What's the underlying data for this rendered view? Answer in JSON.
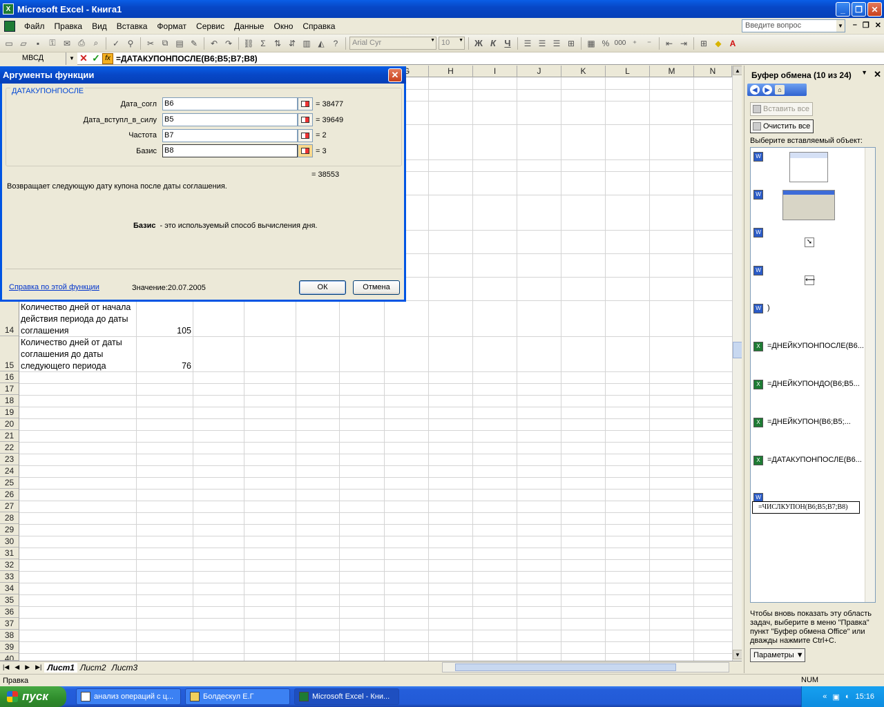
{
  "window": {
    "title": "Microsoft Excel - Книга1",
    "app_icon": "X"
  },
  "menu": {
    "items": [
      "Файл",
      "Правка",
      "Вид",
      "Вставка",
      "Формат",
      "Сервис",
      "Данные",
      "Окно",
      "Справка"
    ],
    "ask_placeholder": "Введите вопрос"
  },
  "toolbar": {
    "font_name": "Arial Cyr",
    "font_size": "10",
    "bold": "Ж",
    "italic": "К",
    "underline": "Ч",
    "percent": "%",
    "thousands": "000",
    "sigma": "Σ"
  },
  "formula_bar": {
    "name_box": "МВСД",
    "formula": "=ДАТАКУПОНПОСЛЕ(B6;B5;B7;B8)",
    "fx": "fx"
  },
  "grid": {
    "columns": [
      "G",
      "H",
      "I",
      "J",
      "K",
      "L",
      "M",
      "N"
    ],
    "rows": [
      "14",
      "15",
      "16",
      "17",
      "18",
      "19",
      "20",
      "21",
      "22",
      "23",
      "24",
      "25",
      "26",
      "27",
      "28",
      "29",
      "30",
      "31",
      "32",
      "33",
      "34",
      "35",
      "36",
      "37",
      "38",
      "39",
      "40"
    ],
    "cells": [
      {
        "row": "14",
        "lines": [
          "Количество дней от начала",
          "действия периода до даты",
          "соглашения"
        ],
        "value": "105"
      },
      {
        "row": "15",
        "lines": [
          "Количество дней от даты",
          "соглашения до даты",
          "следующего периода"
        ],
        "value": "76"
      }
    ]
  },
  "sheets": {
    "tabs": [
      "Лист1",
      "Лист2",
      "Лист3"
    ],
    "active": "Лист1"
  },
  "status": {
    "left": "Правка",
    "num": "NUM"
  },
  "dialog": {
    "title": "Аргументы функции",
    "function_name": "ДАТАКУПОНПОСЛЕ",
    "args": [
      {
        "label": "Дата_согл",
        "input": "B6",
        "value": "= 38477"
      },
      {
        "label": "Дата_вступл_в_силу",
        "input": "B5",
        "value": "= 39649"
      },
      {
        "label": "Частота",
        "input": "B7",
        "value": "= 2"
      },
      {
        "label": "Базис",
        "input": "B8",
        "value": "= 3"
      }
    ],
    "result": "= 38553",
    "description": "Возвращает следующую дату купона после даты соглашения.",
    "arg_name": "Базис",
    "arg_description": "- это используемый способ вычисления дня.",
    "help_link": "Справка по этой функции",
    "value_label": "Значение:",
    "value": "20.07.2005",
    "ok": "ОК",
    "cancel": "Отмена"
  },
  "taskpane": {
    "title": "Буфер обмена (10 из 24)",
    "paste_all": "Вставить все",
    "clear_all": "Очистить все",
    "select_label": "Выберите вставляемый объект:",
    "items": [
      {
        "type": "word",
        "kind": "image"
      },
      {
        "type": "word",
        "kind": "image"
      },
      {
        "type": "word",
        "kind": "arrow",
        "glyph": "➘"
      },
      {
        "type": "word",
        "kind": "arrow",
        "glyph": "⟵"
      },
      {
        "type": "word",
        "kind": "text",
        "text": ")"
      },
      {
        "type": "excel",
        "kind": "text",
        "text": "=ДНЕЙКУПОНПОСЛЕ(B6..."
      },
      {
        "type": "excel",
        "kind": "text",
        "text": "=ДНЕЙКУПОНДО(B6;B5..."
      },
      {
        "type": "excel",
        "kind": "text",
        "text": "=ДНЕЙКУПОН(B6;B5;..."
      },
      {
        "type": "excel",
        "kind": "text",
        "text": "=ДАТАКУПОНПОСЛЕ(B6..."
      },
      {
        "type": "word",
        "kind": "formula",
        "text": "=ЧИСЛКУПОН(B6;B5;B7;B8)"
      }
    ],
    "note": "Чтобы вновь показать эту область задач, выберите в меню \"Правка\" пункт \"Буфер обмена Office\" или дважды нажмите Ctrl+C.",
    "params": "Параметры"
  },
  "taskbar": {
    "start": "пуск",
    "tasks": [
      "анализ операций с ц...",
      "Болдескул Е.Г",
      "Microsoft Excel - Кни..."
    ],
    "lang": "RL",
    "clock": "15:16"
  }
}
